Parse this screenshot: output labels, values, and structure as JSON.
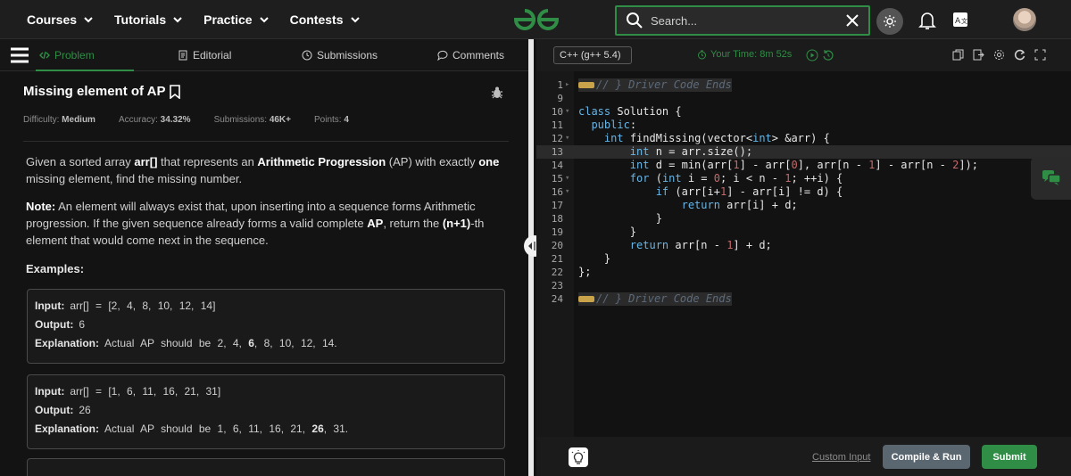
{
  "nav": {
    "links": [
      "Courses",
      "Tutorials",
      "Practice",
      "Contests"
    ],
    "search_placeholder": "Search..."
  },
  "tabs": [
    "Problem",
    "Editorial",
    "Submissions",
    "Comments"
  ],
  "problem": {
    "title": "Missing element of AP",
    "meta": {
      "difficulty_label": "Difficulty:",
      "difficulty": "Medium",
      "accuracy_label": "Accuracy:",
      "accuracy": "34.32%",
      "submissions_label": "Submissions:",
      "submissions": "46K+",
      "points_label": "Points:",
      "points": "4"
    },
    "statement": {
      "p1": "Given a sorted array ",
      "p1_arr": "arr[]",
      "p1_b": " that represents an ",
      "p1_ap": "Arithmetic Progression",
      "p1_c": " (AP) with exactly ",
      "p1_one": "one",
      "p1_d": " missing element, find the missing number."
    },
    "note": {
      "label": "Note:",
      "a": " An element will always exist that, upon inserting into a sequence forms Arithmetic progression. If the given sequence already forms a valid complete ",
      "ap": "AP",
      "b": ", return the ",
      "n1": "(n+1)",
      "c": "-th element that would come next in the sequence."
    },
    "examples_heading": "Examples:",
    "examples": [
      {
        "input_label": "Input:",
        "input": "arr[] = [2, 4, 8, 10, 12, 14]",
        "output_label": "Output:",
        "output": "6",
        "explanation_label": "Explanation:",
        "explanation_a": "Actual AP should be 2, 4, ",
        "explanation_b": "6",
        "explanation_c": ", 8, 10, 12, 14."
      },
      {
        "input_label": "Input:",
        "input": "arr[] = [1, 6, 11, 16, 21, 31]",
        "output_label": "Output:",
        "output": "26",
        "explanation_label": "Explanation:",
        "explanation_a": "Actual AP should be 1, 6, 11, 16, 21, ",
        "explanation_b": "26",
        "explanation_c": ", 31."
      }
    ]
  },
  "editor": {
    "language": "C++ (g++ 5.4)",
    "timer": "Your Time: 8m 52s",
    "line_numbers": [
      "1",
      "9",
      "10",
      "11",
      "12",
      "13",
      "14",
      "15",
      "16",
      "17",
      "18",
      "19",
      "20",
      "21",
      "22",
      "23",
      "24"
    ],
    "comment_top": "// } Driver Code Ends",
    "comment_bottom": "// } Driver Code Ends",
    "custom_input": "Custom Input",
    "compile_run": "Compile & Run",
    "submit": "Submit"
  },
  "colors": {
    "accent": "#2f8d46",
    "keyword": "#66b6e8",
    "number": "#c46a6a"
  }
}
